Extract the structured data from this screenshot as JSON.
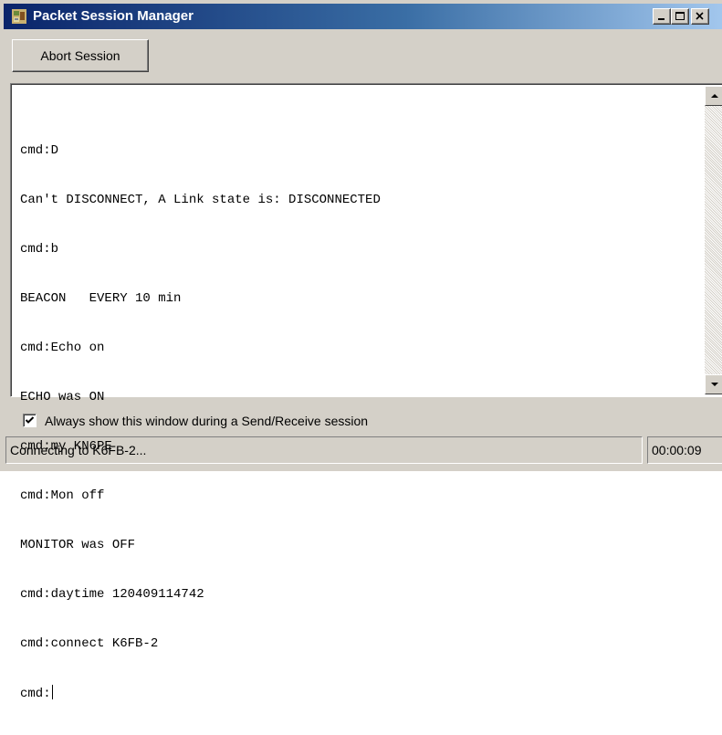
{
  "window": {
    "title": "Packet Session Manager",
    "app_icon": "packet-radio-icon",
    "caption_buttons": [
      "minimize-icon",
      "maximize-icon",
      "close-icon"
    ]
  },
  "toolbar": {
    "abort_label": "Abort Session"
  },
  "console": {
    "lines": [
      "cmd:D",
      "Can't DISCONNECT, A Link state is: DISCONNECTED",
      "cmd:b",
      "BEACON   EVERY 10 min",
      "cmd:Echo on",
      "ECHO was ON",
      "cmd:my KN6PE",
      "cmd:Mon off",
      "MONITOR was OFF",
      "cmd:daytime 120409114742",
      "cmd:connect K6FB-2"
    ],
    "prompt": "cmd:"
  },
  "options": {
    "always_show_label": "Always show this window during a Send/Receive session",
    "always_show_checked": true
  },
  "status": {
    "message": "Connecting to K6FB-2...",
    "elapsed": "00:00:09"
  }
}
